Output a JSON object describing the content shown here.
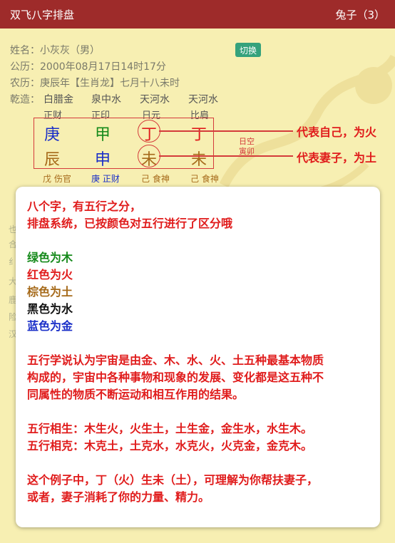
{
  "header": {
    "title": "双飞八字排盘",
    "right_label": "兔子（3）"
  },
  "profile": {
    "name_label": "姓名：",
    "name_value": "小灰灰（男）",
    "gongli_label": "公历：",
    "gongli_value": "2000年08月17日14时17分",
    "nongli_label": "农历：",
    "nongli_value": "庚辰年【生肖龙】七月十八未时",
    "switch_label": "切换"
  },
  "qianzao": {
    "label": "乾造：",
    "nayin": [
      "白腊金",
      "泉中水",
      "天河水",
      "天河水"
    ],
    "shishen_top": [
      "正财",
      "正印",
      "日元",
      "比肩"
    ],
    "tiangan": [
      "庚",
      "甲",
      "丁",
      "丁"
    ],
    "dizhi": [
      "辰",
      "申",
      "未",
      "未"
    ],
    "canggan": [
      "戊 伤官",
      "庚 正财",
      "己 食神",
      "己 食神"
    ],
    "kongwang_1": "日空",
    "kongwang_2": "寅卯"
  },
  "annotations": {
    "self": "代表自己，为火",
    "wife": "代表妻子，为土"
  },
  "left_hidden": [
    "也",
    "合",
    "纟",
    "大",
    "鹿",
    "险",
    "汉"
  ],
  "panel": {
    "p1": "八个字，有五行之分，",
    "p2": "排盘系统，已按颜色对五行进行了区分哦",
    "wood": "绿色为木",
    "fire": "红色为火",
    "earth": "棕色为土",
    "water": "黑色为水",
    "metal": "蓝色为金",
    "theory_1": "五行学说认为宇宙是由金、木、水、火、土五种最基本物质",
    "theory_2": "构成的，宇宙中各种事物和现象的发展、变化都是这五种不",
    "theory_3": "同属性的物质不断运动和相互作用的结果。",
    "sheng": "五行相生：木生火，火生土，土生金，金生水，水生木。",
    "ke": "五行相克：木克土，土克水，水克火，火克金，金克木。",
    "example_1": "这个例子中，丁（火）生未（土），可理解为你帮扶妻子，",
    "example_2": "或者，妻子消耗了你的力量、精力。"
  },
  "colors": {
    "header_bg": "#9e2b2a",
    "page_bg": "#f7efb2",
    "accent_red": "#e01c1c",
    "wood_green": "#168a1b",
    "earth_brown": "#a66a1a",
    "metal_blue": "#1a2fc8",
    "switch_green": "#35a27c"
  }
}
